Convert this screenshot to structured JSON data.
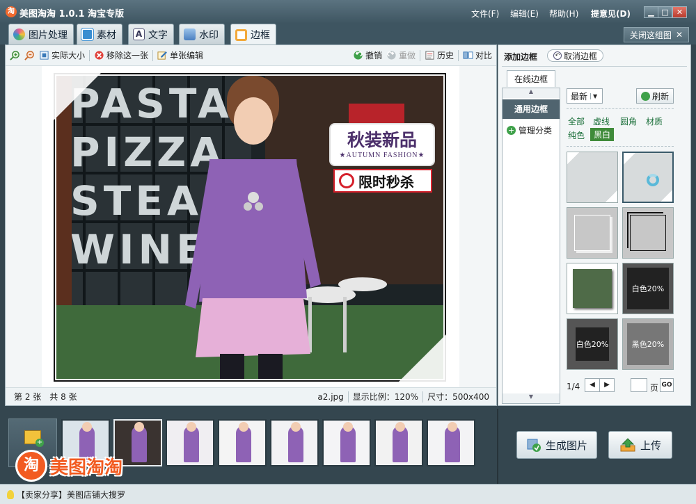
{
  "app": {
    "logo_glyph": "淘",
    "title": "美图淘淘 1.0.1 淘宝专版",
    "menu": [
      "文件(F)",
      "编辑(E)",
      "帮助(H)",
      "提意见(D)"
    ],
    "win_min": "▁",
    "win_max": "□",
    "win_close": "✕"
  },
  "tabs": [
    {
      "label": "图片处理",
      "icon": "palette-icon",
      "color": "#e85a8f"
    },
    {
      "label": "素材",
      "icon": "sticker-icon",
      "color": "#3a8ed1"
    },
    {
      "label": "文字",
      "icon": "text-icon",
      "color": "#ffffff"
    },
    {
      "label": "水印",
      "icon": "watermark-icon",
      "color": "#4a7fc0"
    },
    {
      "label": "边框",
      "icon": "frame-icon",
      "color": "#f2a93b"
    }
  ],
  "close_group": {
    "label": "关闭这组图",
    "icon": "close-icon"
  },
  "toolbar": {
    "actual_size": "实际大小",
    "remove_one": "移除这一张",
    "single_edit": "单张编辑",
    "undo": "撤销",
    "redo": "重做",
    "history": "历史",
    "compare": "对比"
  },
  "photo": {
    "badge_title": "秋装新品",
    "badge_sub": "★AUTUMN FASHION★",
    "badge_sale": "限时秒杀",
    "sign_text": "PASTA PIZZA STEAK WINE"
  },
  "status": {
    "index": "第 2 张",
    "total": "共 8 张",
    "filename": "a2.jpg",
    "zoom": "显示比例：120%",
    "size": "尺寸：500x400"
  },
  "right_panel": {
    "title": "添加边框",
    "cancel": "取消边框",
    "online_tab": "在线边框",
    "category_active": "通用边框",
    "manage": "管理分类",
    "sort": "最新",
    "refresh": "刷新",
    "filters": [
      "全部",
      "虚线",
      "圆角",
      "材质",
      "纯色",
      "黑白"
    ],
    "selected_filter": "黑白",
    "thumb_labels": [
      "白色20%",
      "白色20%",
      "黑色20%"
    ],
    "page": "1/4",
    "page_suffix": "页",
    "go": "GO"
  },
  "filmstrip": {
    "count": 8,
    "active_index": 1
  },
  "buttons": {
    "generate": "生成图片",
    "upload": "上传"
  },
  "brand": {
    "glyph": "淘",
    "text": "美图淘淘"
  },
  "footer": {
    "text": "【卖家分享】美图店铺大搜罗"
  }
}
